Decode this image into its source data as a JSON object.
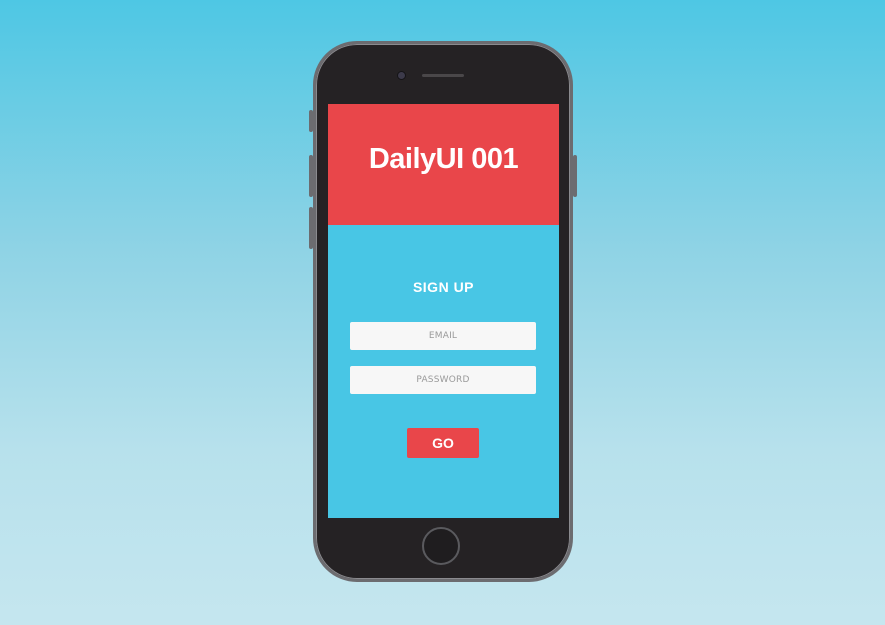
{
  "app": {
    "title": "DailyUI 001"
  },
  "form": {
    "title": "SIGN UP",
    "email": {
      "placeholder": "EMAIL",
      "value": ""
    },
    "password": {
      "placeholder": "PASSWORD",
      "value": ""
    },
    "submit_label": "GO"
  },
  "colors": {
    "background_top": "#4ec7e4",
    "background_bottom": "#c5e6ef",
    "accent_red": "#e9464a",
    "screen_blue": "#48c6e5",
    "phone_body": "#252224"
  },
  "icons": {
    "camera": "camera-icon",
    "speaker": "speaker-icon",
    "home": "home-button-icon"
  }
}
